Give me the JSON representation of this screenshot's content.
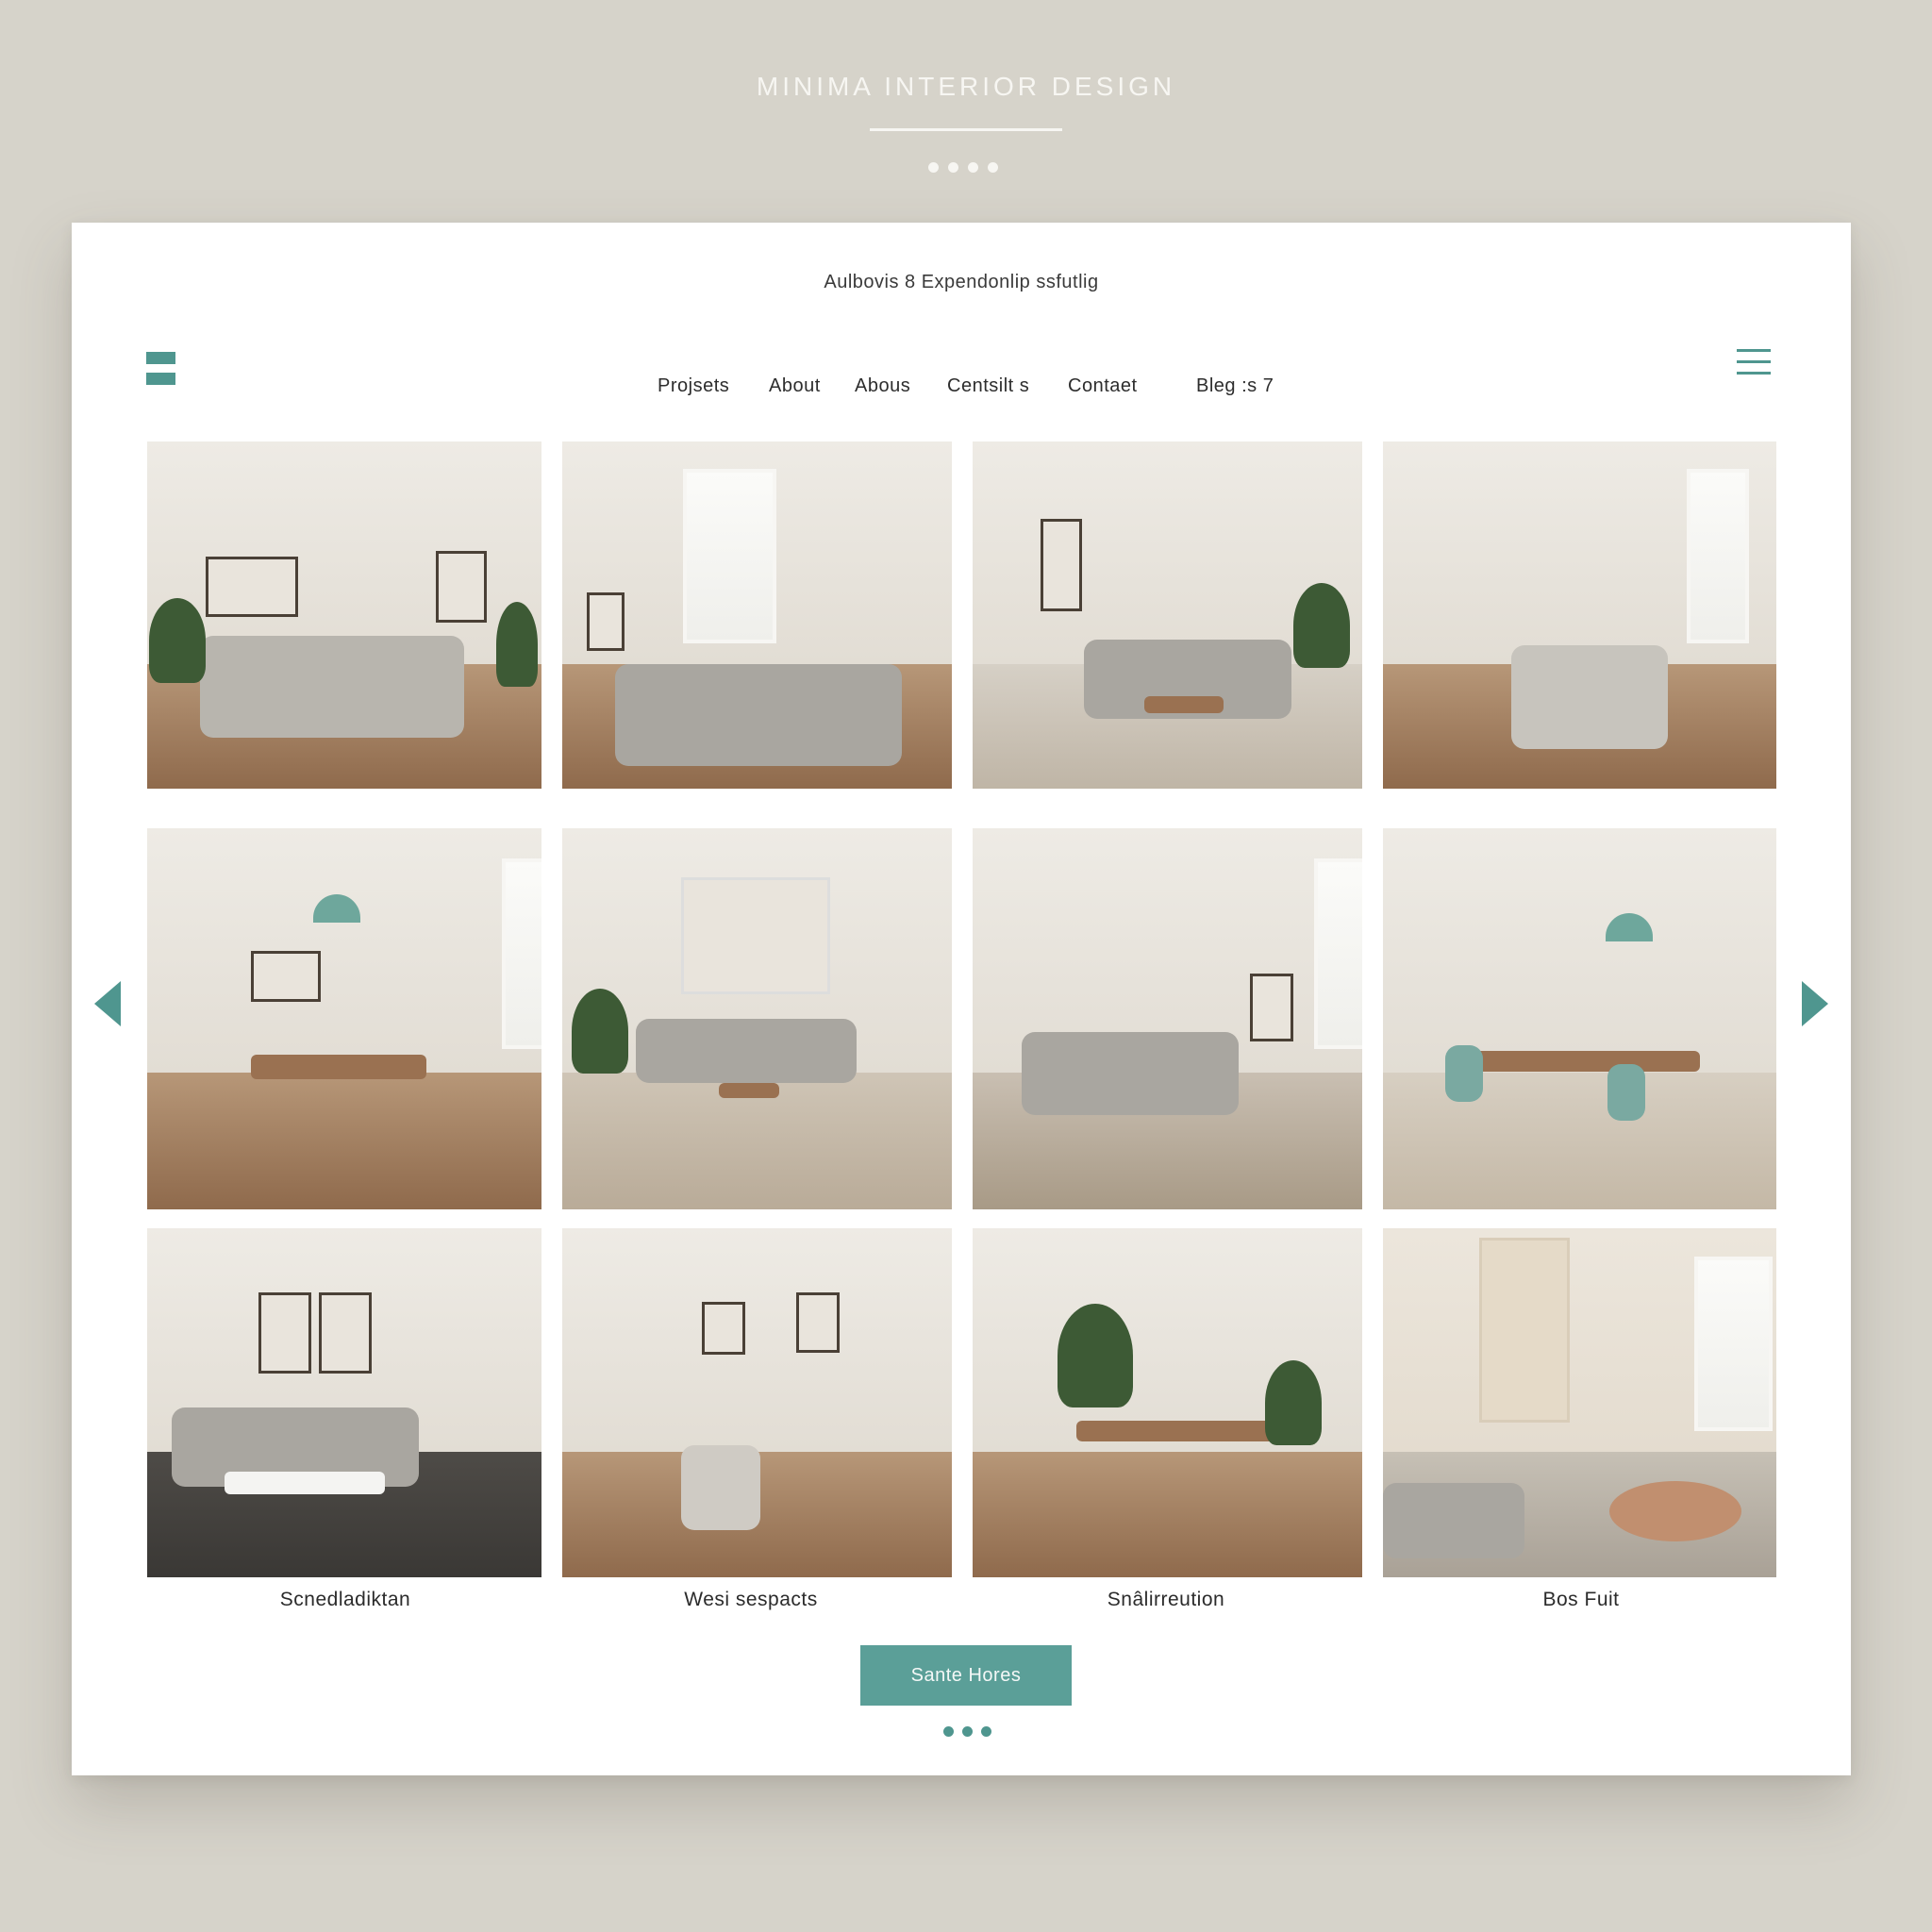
{
  "brand": {
    "title": "MINIMA INTERIOR DESIGN"
  },
  "tagline": "Aulbovis 8 Expendonlip ssfutlig",
  "nav": {
    "items": [
      {
        "label": "Projsets"
      },
      {
        "label": "About"
      },
      {
        "label": "Abous"
      },
      {
        "label": "Centsilt s"
      },
      {
        "label": "Contaet"
      },
      {
        "label": "Bleg :s 7"
      }
    ]
  },
  "icons": {
    "logo": "logo-mark-icon",
    "menu": "hamburger-menu-icon",
    "prev": "chevron-left-icon",
    "next": "chevron-right-icon"
  },
  "gallery": {
    "captions": [
      "Scnedladiktan",
      "Wesi sespacts",
      "Snâlirreution",
      "Bos Fuit"
    ]
  },
  "cta": {
    "label": "Sante Hores"
  },
  "colors": {
    "accent": "#4f968f",
    "button": "#5b9f98",
    "background": "#d6d3ca",
    "card": "#ffffff"
  }
}
